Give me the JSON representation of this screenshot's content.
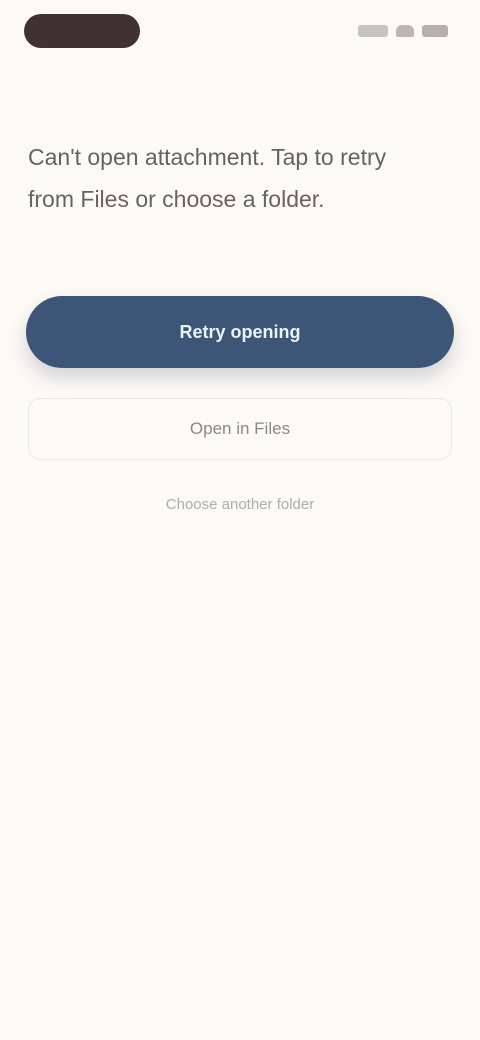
{
  "prompt": {
    "text": "Can't open attachment. Tap to retry from Files or choose a folder."
  },
  "actions": {
    "primary": "Retry opening",
    "secondary": "Open in Files",
    "tertiary": "Choose another folder"
  },
  "colors": {
    "background": "#fdf9f4",
    "primary": "#3d5677",
    "text": "#6a625e"
  }
}
